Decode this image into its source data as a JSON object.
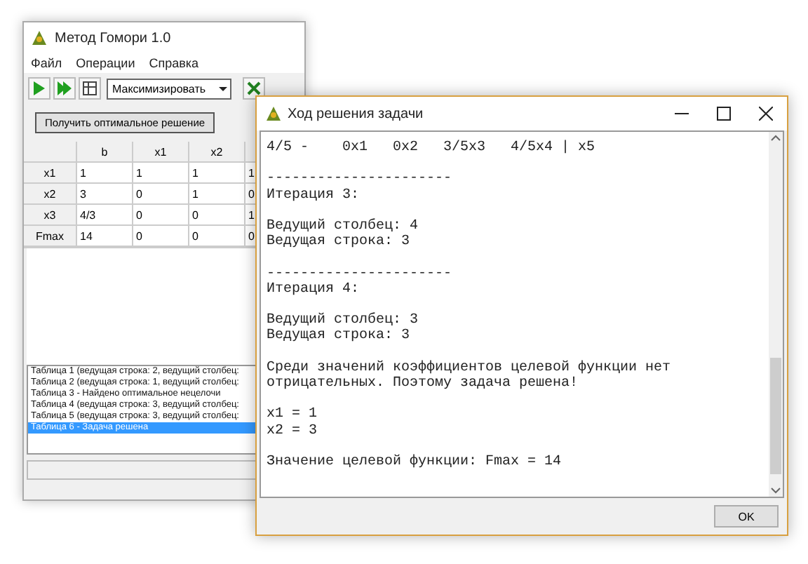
{
  "main_window": {
    "title": "Метод Гомори 1.0",
    "menu": [
      "Файл",
      "Операции",
      "Справка"
    ],
    "mode_select": {
      "value": "Максимизировать"
    },
    "solve_button": "Получить оптимальное решение",
    "table": {
      "columns": [
        "",
        "b",
        "x1",
        "x2",
        ""
      ],
      "rows": [
        [
          "x1",
          "1",
          "1",
          "1",
          "1"
        ],
        [
          "x2",
          "3",
          "0",
          "1",
          "0"
        ],
        [
          "x3",
          "4/3",
          "0",
          "0",
          "1"
        ],
        [
          "Fmax",
          "14",
          "0",
          "0",
          "0"
        ]
      ]
    },
    "tables_list": [
      {
        "label": "Таблица 1 (ведущая строка: 2, ведущий столбец:",
        "selected": false
      },
      {
        "label": "Таблица 2 (ведущая строка: 1, ведущий столбец:",
        "selected": false
      },
      {
        "label": "Таблица 3 - Найдено оптимальное нецелочи",
        "selected": false
      },
      {
        "label": "Таблица 4 (ведущая строка: 3, ведущий столбец:",
        "selected": false
      },
      {
        "label": "Таблица 5 (ведущая строка: 3, ведущий столбец:",
        "selected": false
      },
      {
        "label": "Таблица 6 - Задача решена",
        "selected": true
      }
    ]
  },
  "dialog": {
    "title": "Ход решения задачи",
    "paragraphs": [
      [
        "4/5 -    0x1   0x2   3/5x3   4/5x4 | x5"
      ],
      [
        "----------------------",
        "Итерация 3:"
      ],
      [
        "Ведущий столбец: 4",
        "Ведущая строка: 3"
      ],
      [
        "----------------------",
        "Итерация 4:"
      ],
      [
        "Ведущий столбец: 3",
        "Ведущая строка: 3"
      ],
      [
        "Среди значений коэффициентов целевой функции нет",
        "отрицательных. Поэтому задача решена!"
      ],
      [
        "x1 = 1",
        "x2 = 3"
      ],
      [
        "Значение целевой функции: Fmax = 14"
      ]
    ],
    "ok_button": "OK"
  }
}
